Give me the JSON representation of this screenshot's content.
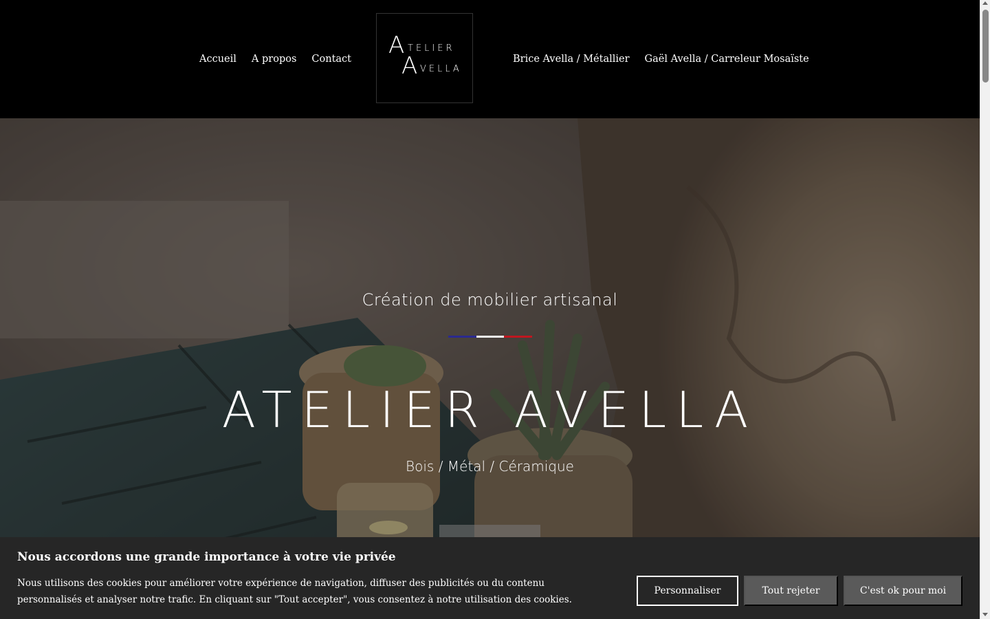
{
  "nav": {
    "left": [
      {
        "label": "Accueil"
      },
      {
        "label": "A propos"
      },
      {
        "label": "Contact"
      }
    ],
    "right": [
      {
        "label": "Brice Avella / Métallier"
      },
      {
        "label": "Gaël Avella / Carreleur Mosaïste"
      }
    ]
  },
  "logo": {
    "line1_initial": "A",
    "line1_rest": "TELIER",
    "line2_initial": "A",
    "line2_rest": "VELLA"
  },
  "hero": {
    "subtitle": "Création de mobilier artisanal",
    "title": "ATELIER AVELLA",
    "tagline": "Bois / Métal / Céramique",
    "flag_colors": [
      "#2b2a8f",
      "#f2f2f2",
      "#c0161f"
    ]
  },
  "cookie": {
    "title": "Nous accordons une grande importance à votre vie privée",
    "text": "Nous utilisons des cookies pour améliorer votre expérience de navigation, diffuser des publicités ou du contenu personnalisés et analyser notre trafic. En cliquant sur \"Tout accepter\", vous consentez à notre utilisation des cookies.",
    "customize_label": "Personnaliser",
    "reject_label": "Tout rejeter",
    "accept_label": "C'est ok pour moi"
  }
}
